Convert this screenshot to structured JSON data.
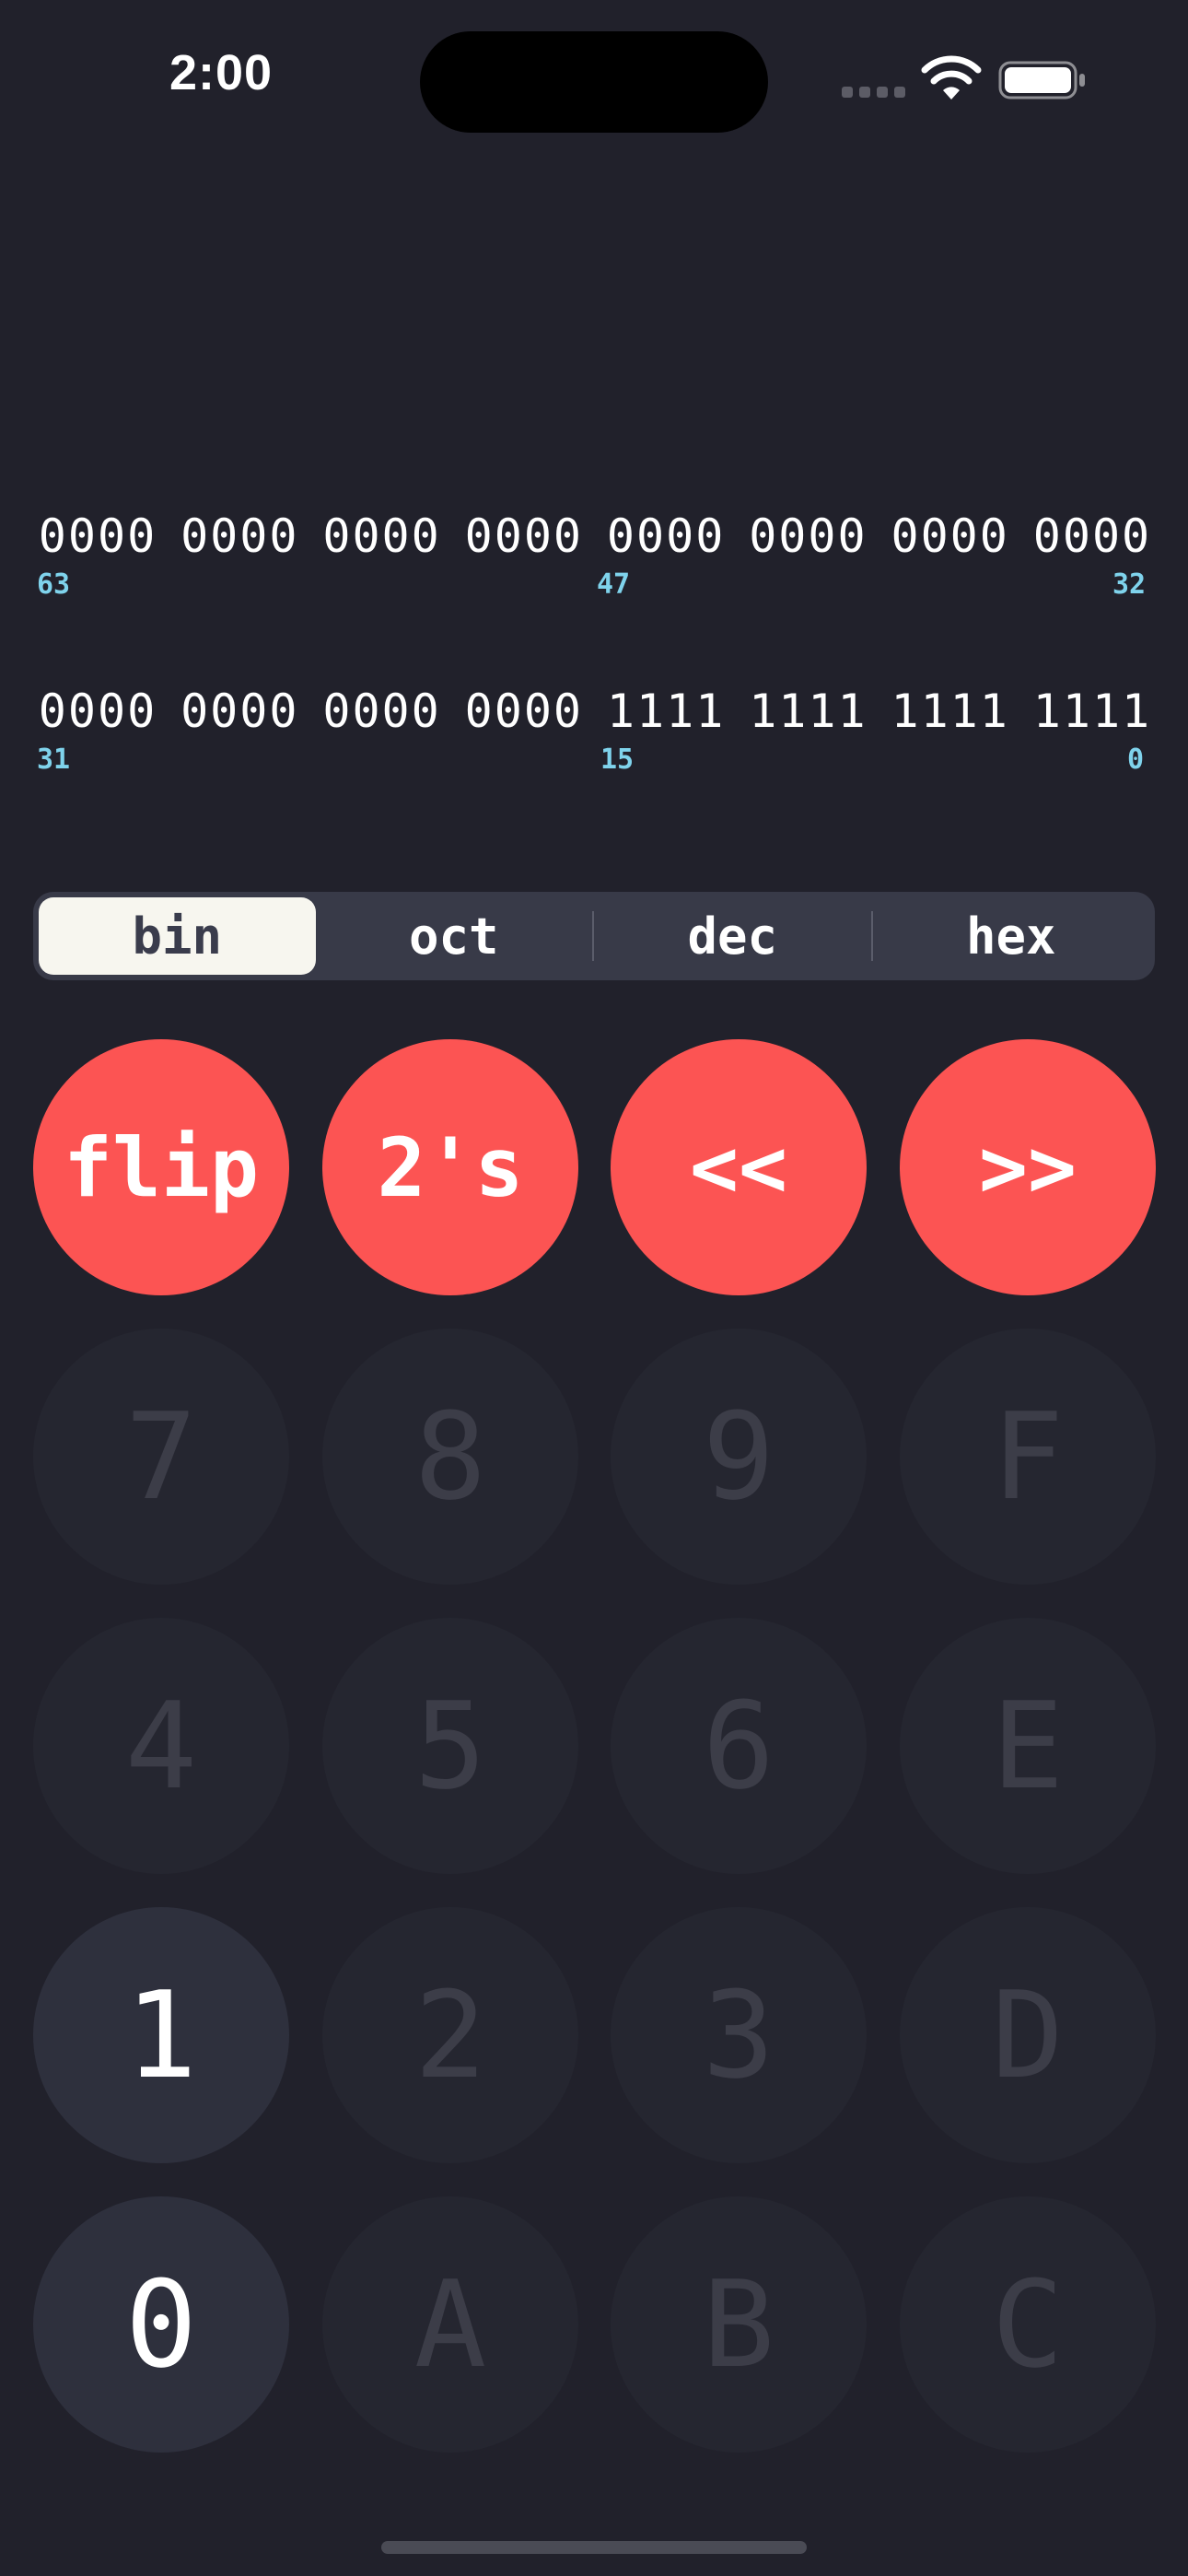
{
  "status_bar": {
    "time": "2:00"
  },
  "bits": {
    "upper": {
      "groups": [
        "0000",
        "0000",
        "0000",
        "0000",
        "0000",
        "0000",
        "0000",
        "0000"
      ],
      "index_left": "63",
      "index_mid": "47",
      "index_right": "32"
    },
    "lower": {
      "groups": [
        "0000",
        "0000",
        "0000",
        "0000",
        "1111",
        "1111",
        "1111",
        "1111"
      ],
      "index_left": "31",
      "index_mid": "15",
      "index_right": "0"
    }
  },
  "base_selector": {
    "selected": "bin",
    "options": [
      "bin",
      "oct",
      "dec",
      "hex"
    ]
  },
  "operations": {
    "flip": "flip",
    "twos": "2's",
    "shift_left": "<<",
    "shift_right": ">>"
  },
  "keys": {
    "k7": "7",
    "k8": "8",
    "k9": "9",
    "kF": "F",
    "k4": "4",
    "k5": "5",
    "k6": "6",
    "kE": "E",
    "k1": "1",
    "k2": "2",
    "k3": "3",
    "kD": "D",
    "k0": "0",
    "kA": "A",
    "kB": "B",
    "kC": "C"
  },
  "colors": {
    "background": "#21212b",
    "accent": "#fc5453",
    "bit_index": "#7fd3ec",
    "segment_selected": "#f7f6ef"
  }
}
